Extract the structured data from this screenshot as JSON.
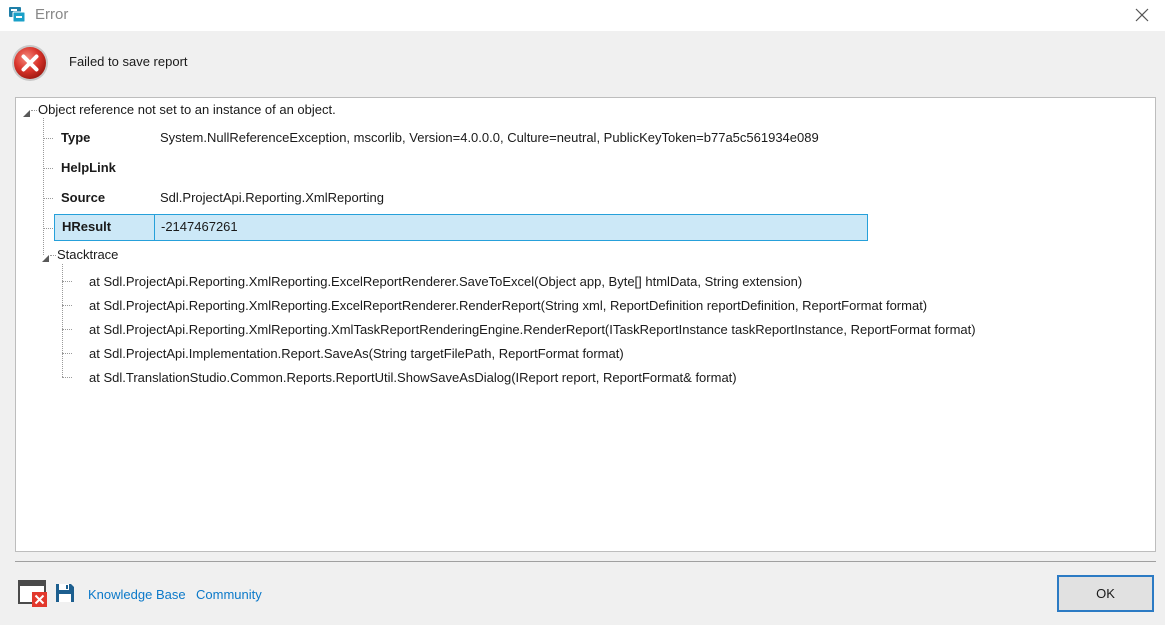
{
  "window": {
    "title": "Error",
    "close_icon": "close-icon"
  },
  "message": {
    "icon": "error-icon",
    "text": "Failed to save report"
  },
  "tree": {
    "root_label": "Object reference not set to an instance of an object.",
    "properties": [
      {
        "key": "Type",
        "value": "System.NullReferenceException, mscorlib, Version=4.0.0.0, Culture=neutral, PublicKeyToken=b77a5c561934e089"
      },
      {
        "key": "HelpLink",
        "value": ""
      },
      {
        "key": "Source",
        "value": "Sdl.ProjectApi.Reporting.XmlReporting"
      },
      {
        "key": "HResult",
        "value": "-2147467261",
        "selected": true
      }
    ],
    "stacktrace_label": "Stacktrace",
    "stacktrace": [
      "at Sdl.ProjectApi.Reporting.XmlReporting.ExcelReportRenderer.SaveToExcel(Object app, Byte[] htmlData, String extension)",
      "at Sdl.ProjectApi.Reporting.XmlReporting.ExcelReportRenderer.RenderReport(String xml, ReportDefinition reportDefinition, ReportFormat format)",
      "at Sdl.ProjectApi.Reporting.XmlReporting.XmlTaskReportRenderingEngine.RenderReport(ITaskReportInstance taskReportInstance, ReportFormat format)",
      "at Sdl.ProjectApi.Implementation.Report.SaveAs(String targetFilePath, ReportFormat format)",
      "at Sdl.TranslationStudio.Common.Reports.ReportUtil.ShowSaveAsDialog(IReport report, ReportFormat& format)"
    ]
  },
  "footer": {
    "icons": [
      "window-error-icon",
      "save-icon"
    ],
    "knowledge_base_label": "Knowledge Base",
    "community_label": "Community",
    "ok_label": "OK"
  },
  "colors": {
    "selection_bg": "#cce8f7",
    "selection_border": "#26a0da",
    "link": "#0b79c9",
    "ok_border": "#2c7bc4",
    "error_red": "#d9342b"
  }
}
